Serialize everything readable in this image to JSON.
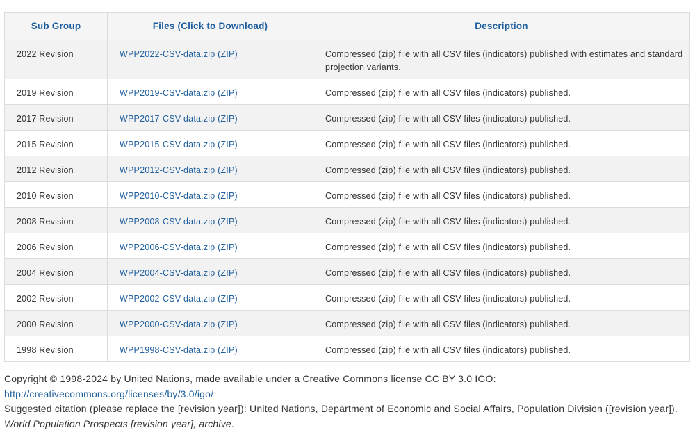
{
  "table": {
    "headers": {
      "subgroup": "Sub Group",
      "files": "Files (Click to Download)",
      "description": "Description"
    },
    "rows": [
      {
        "subgroup": "2022 Revision",
        "file": "WPP2022-CSV-data.zip (ZIP)",
        "description": "Compressed (zip) file with all CSV files (indicators) published with estimates and standard projection variants."
      },
      {
        "subgroup": "2019 Revision",
        "file": "WPP2019-CSV-data.zip (ZIP)",
        "description": "Compressed (zip) file with all CSV files (indicators) published."
      },
      {
        "subgroup": "2017 Revision",
        "file": "WPP2017-CSV-data.zip (ZIP)",
        "description": "Compressed (zip) file with all CSV files (indicators) published."
      },
      {
        "subgroup": "2015 Revision",
        "file": "WPP2015-CSV-data.zip (ZIP)",
        "description": "Compressed (zip) file with all CSV files (indicators) published."
      },
      {
        "subgroup": "2012 Revision",
        "file": "WPP2012-CSV-data.zip (ZIP)",
        "description": "Compressed (zip) file with all CSV files (indicators) published."
      },
      {
        "subgroup": "2010 Revision",
        "file": "WPP2010-CSV-data.zip (ZIP)",
        "description": "Compressed (zip) file with all CSV files (indicators) published."
      },
      {
        "subgroup": "2008 Revision",
        "file": "WPP2008-CSV-data.zip (ZIP)",
        "description": "Compressed (zip) file with all CSV files (indicators) published."
      },
      {
        "subgroup": "2006 Revision",
        "file": "WPP2006-CSV-data.zip (ZIP)",
        "description": "Compressed (zip) file with all CSV files (indicators) published."
      },
      {
        "subgroup": "2004 Revision",
        "file": "WPP2004-CSV-data.zip (ZIP)",
        "description": "Compressed (zip) file with all CSV files (indicators) published."
      },
      {
        "subgroup": "2002 Revision",
        "file": "WPP2002-CSV-data.zip (ZIP)",
        "description": "Compressed (zip) file with all CSV files (indicators) published."
      },
      {
        "subgroup": "2000 Revision",
        "file": "WPP2000-CSV-data.zip (ZIP)",
        "description": "Compressed (zip) file with all CSV files (indicators) published."
      },
      {
        "subgroup": "1998 Revision",
        "file": "WPP1998-CSV-data.zip (ZIP)",
        "description": "Compressed (zip) file with all CSV files (indicators) published."
      }
    ]
  },
  "footer": {
    "copyright_text": "Copyright © 1998-2024 by United Nations, made available under a Creative Commons license CC BY 3.0 IGO:",
    "license_link": "http://creativecommons.org/licenses/by/3.0/igo/",
    "citation_text": "Suggested citation (please replace the [revision year]): United Nations, Department of Economic and Social Affairs, Population Division ([revision year]).",
    "citation_title": "World Population Prospects [revision year], archive",
    "citation_end": "."
  },
  "colors": {
    "link": "#1f5f9e",
    "header_bg": "#f5f5f5",
    "row_alt_bg": "#f2f2f2",
    "border": "#dcdcdc",
    "text": "#333333"
  }
}
